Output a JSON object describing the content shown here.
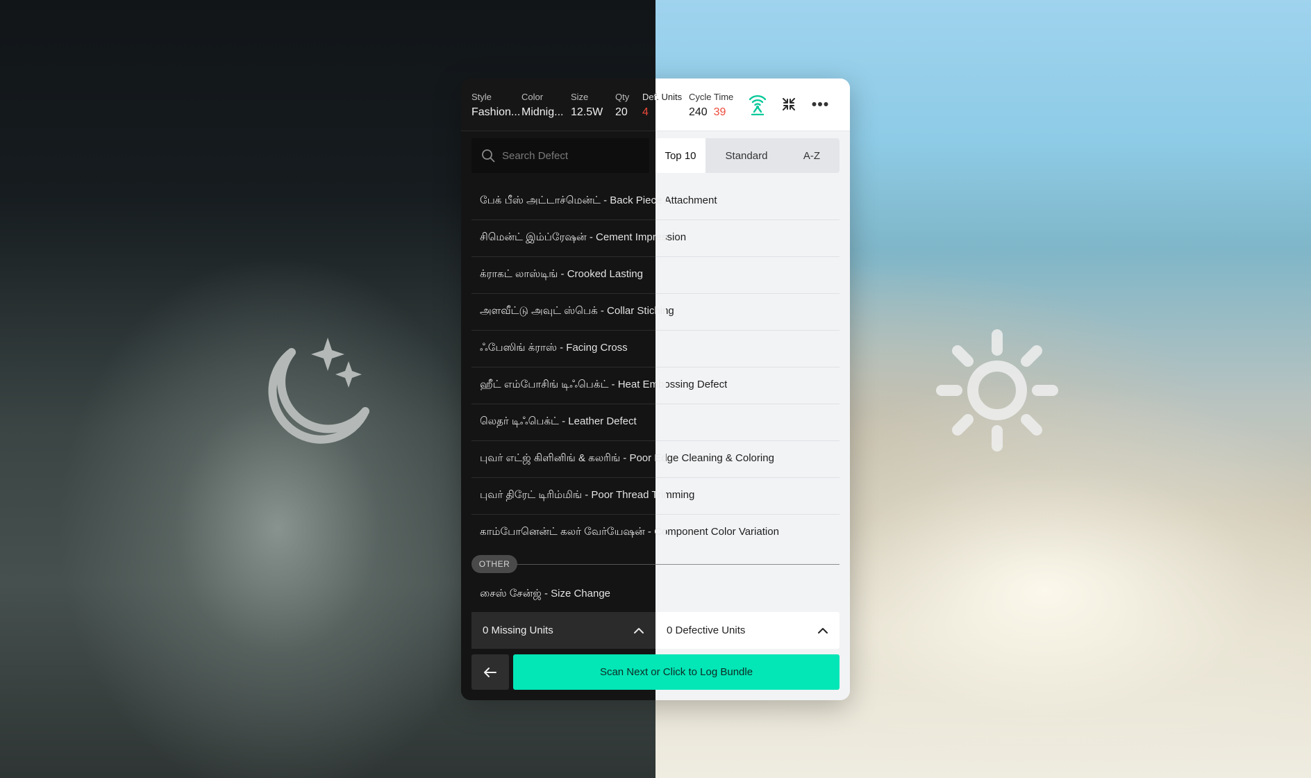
{
  "header": {
    "columns": [
      {
        "label": "Style",
        "value": "Fashion..."
      },
      {
        "label": "Color",
        "value": "Midnig..."
      },
      {
        "label": "Size",
        "value": "12.5W"
      },
      {
        "label": "Qty",
        "value": "20"
      },
      {
        "label": "Def. Units",
        "value": "4"
      },
      {
        "label": "Cycle Time",
        "value": "240",
        "value2": "39"
      }
    ],
    "icons": [
      "wireless-signal-icon",
      "minimize-icon",
      "more-options-icon"
    ]
  },
  "search": {
    "placeholder": "Search Defect"
  },
  "tabs": [
    {
      "label": "Top 10",
      "active": true
    },
    {
      "label": "Standard",
      "active": false
    },
    {
      "label": "A-Z",
      "active": false
    }
  ],
  "defects": [
    "பேக் பீஸ் அட்டாச்மென்ட் - Back Piece Attachment",
    "சிமென்ட் இம்ப்ரேஷன் - Cement Impression",
    "க்ராகட் லாஸ்டிங் - Crooked Lasting",
    " அளவீட்டு அவுட் ஸ்பெக் - Collar Stiching",
    "ஃபேஸிங் க்ராஸ் - Facing Cross",
    "ஹீட் எம்போசிங் டிஃபெக்ட் - Heat Embossing Defect",
    "லெதர் டிஃபெக்ட் - Leather Defect",
    "புவர் எட்ஜ் கிளினிங் & கலரிங் - Poor Edge Cleaning & Coloring",
    "புவர்  திரேட் டிரிம்மிங் - Poor Thread Trimming",
    "காம்போனென்ட் கலர் வேர்யேஷன் - Component Color Variation"
  ],
  "other": {
    "label": "OTHER",
    "items": [
      "சைஸ் சேன்ஜ் - Size Change"
    ]
  },
  "units": {
    "missing": "0 Missing Units",
    "defective": "0 Defective Units"
  },
  "actions": {
    "cta": "Scan Next or Click to Log Bundle"
  },
  "colors": {
    "accent": "#03e6b6",
    "alert": "#ee4a3b",
    "dark_panel": "#141414",
    "light_panel": "#f2f3f5"
  }
}
